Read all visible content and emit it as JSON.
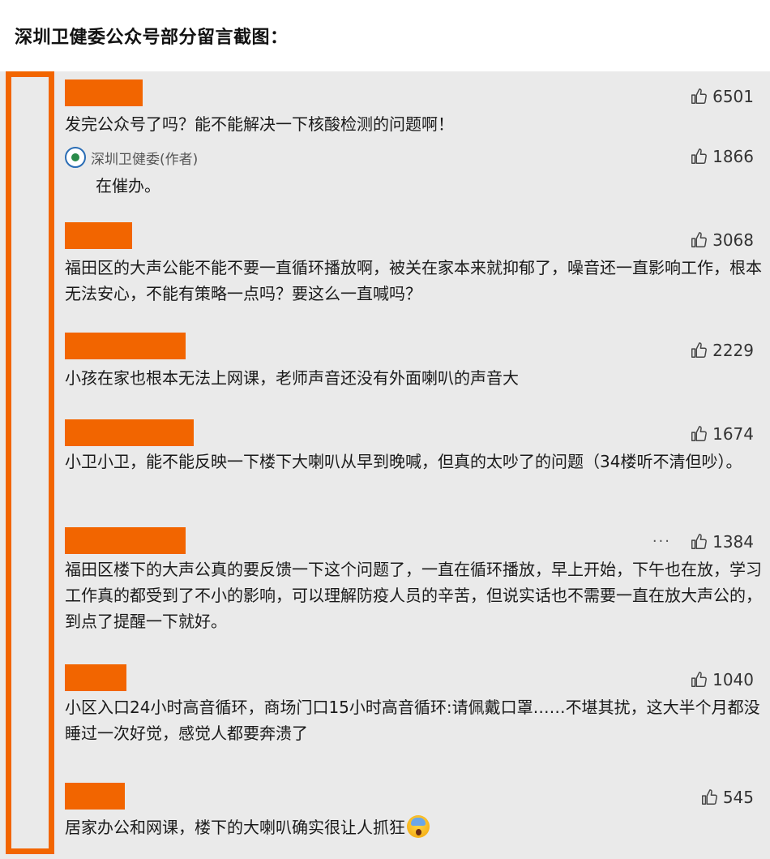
{
  "page_title": "深圳卫健委公众号部分留言截图：",
  "colors": {
    "accent": "#f26500",
    "panel": "#eaeaea"
  },
  "comments": [
    {
      "likes": "6501",
      "text": "发完公众号了吗？能不能解决一下核酸检测的问题啊！",
      "reply": {
        "author": "深圳卫健委(作者)",
        "likes": "1866",
        "text": "在催办。"
      }
    },
    {
      "likes": "3068",
      "text": "福田区的大声公能不能不要一直循环播放啊，被关在家本来就抑郁了，噪音还一直影响工作，根本无法安心，不能有策略一点吗？要这么一直喊吗？"
    },
    {
      "likes": "2229",
      "text": "小孩在家也根本无法上网课，老师声音还没有外面喇叭的声音大"
    },
    {
      "likes": "1674",
      "text": "小卫小卫，能不能反映一下楼下大喇叭从早到晚喊，但真的太吵了的问题（34楼听不清但吵）。"
    },
    {
      "likes": "1384",
      "more": "···",
      "text": "福田区楼下的大声公真的要反馈一下这个问题了，一直在循环播放，早上开始，下午也在放，学习工作真的都受到了不小的影响，可以理解防疫人员的辛苦，但说实话也不需要一直在放大声公的，到点了提醒一下就好。"
    },
    {
      "likes": "1040",
      "text": "小区入口24小时高音循环，商场门口15小时高音循环:请佩戴口罩……不堪其扰，这大半个月都没睡过一次好觉，感觉人都要奔溃了"
    },
    {
      "likes": "545",
      "text": "居家办公和网课，楼下的大喇叭确实很让人抓狂",
      "emoji": "screaming-face-icon"
    }
  ]
}
